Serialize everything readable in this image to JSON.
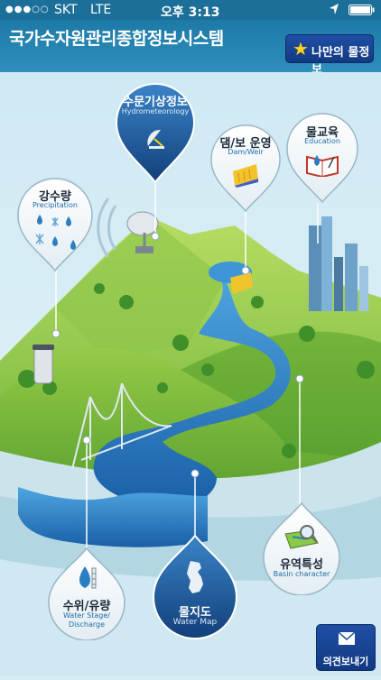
{
  "status_bar": {
    "signal": "●●●○○",
    "carrier": "SKT",
    "network": "LTE",
    "time": "오후 3:13",
    "location_icon": "location-arrow-icon",
    "battery_icon": "battery-icon"
  },
  "header": {
    "title": "국가수자원관리종합정보시스템",
    "my_info_label": "나만의 물정보",
    "my_info_icon": "star-icon"
  },
  "menu": {
    "hydromet": {
      "label_ko": "수문기상정보",
      "label_en": "Hydrometeorology",
      "icon": "radar-dish-icon"
    },
    "dam": {
      "label_ko": "댐/보 운영",
      "label_en": "Dam/Weir",
      "icon": "dam-icon"
    },
    "education": {
      "label_ko": "물교육",
      "label_en": "Education",
      "icon": "book-icon"
    },
    "precipitation": {
      "label_ko": "강수량",
      "label_en": "Precipitation",
      "icon": "rain-snow-icon"
    },
    "water_stage": {
      "label_ko": "수위/유량",
      "label_en_1": "Water Stage/",
      "label_en_2": "Discharge",
      "icon": "water-gauge-icon"
    },
    "water_map": {
      "label_ko": "물지도",
      "label_en": "Water Map",
      "icon": "korea-map-icon"
    },
    "basin": {
      "label_ko": "유역특성",
      "label_en": "Basin character",
      "icon": "magnifier-map-icon"
    }
  },
  "feedback": {
    "label": "의견보내기",
    "icon": "envelope-icon"
  },
  "colors": {
    "header_blue": "#1d7aa6",
    "button_navy": "#1a4a9e",
    "pin_dark": "#1f5fa0",
    "hill_green": "#7cbc3c",
    "river_blue": "#2a84c8"
  }
}
